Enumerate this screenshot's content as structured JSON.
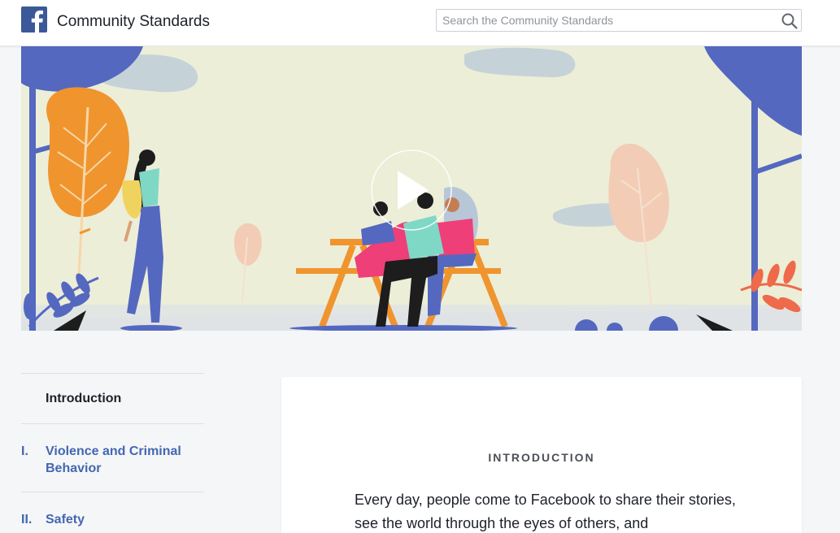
{
  "header": {
    "title": "Community Standards",
    "search_placeholder": "Search the Community Standards",
    "search_value": "",
    "logo_icon": "facebook-logo-icon",
    "search_icon": "search-icon"
  },
  "hero": {
    "play_icon": "play-icon"
  },
  "sidebar": {
    "items": [
      {
        "number": "",
        "label": "Introduction"
      },
      {
        "number": "I.",
        "label": "Violence and Criminal Behavior"
      },
      {
        "number": "II.",
        "label": "Safety"
      }
    ]
  },
  "content": {
    "heading": "INTRODUCTION",
    "body": "Every day, people come to Facebook to share their stories, see the world through the eyes of others, and"
  },
  "colors": {
    "brand": "#3b5998",
    "link": "#4267b2",
    "hero_bg": "#eceed8"
  }
}
